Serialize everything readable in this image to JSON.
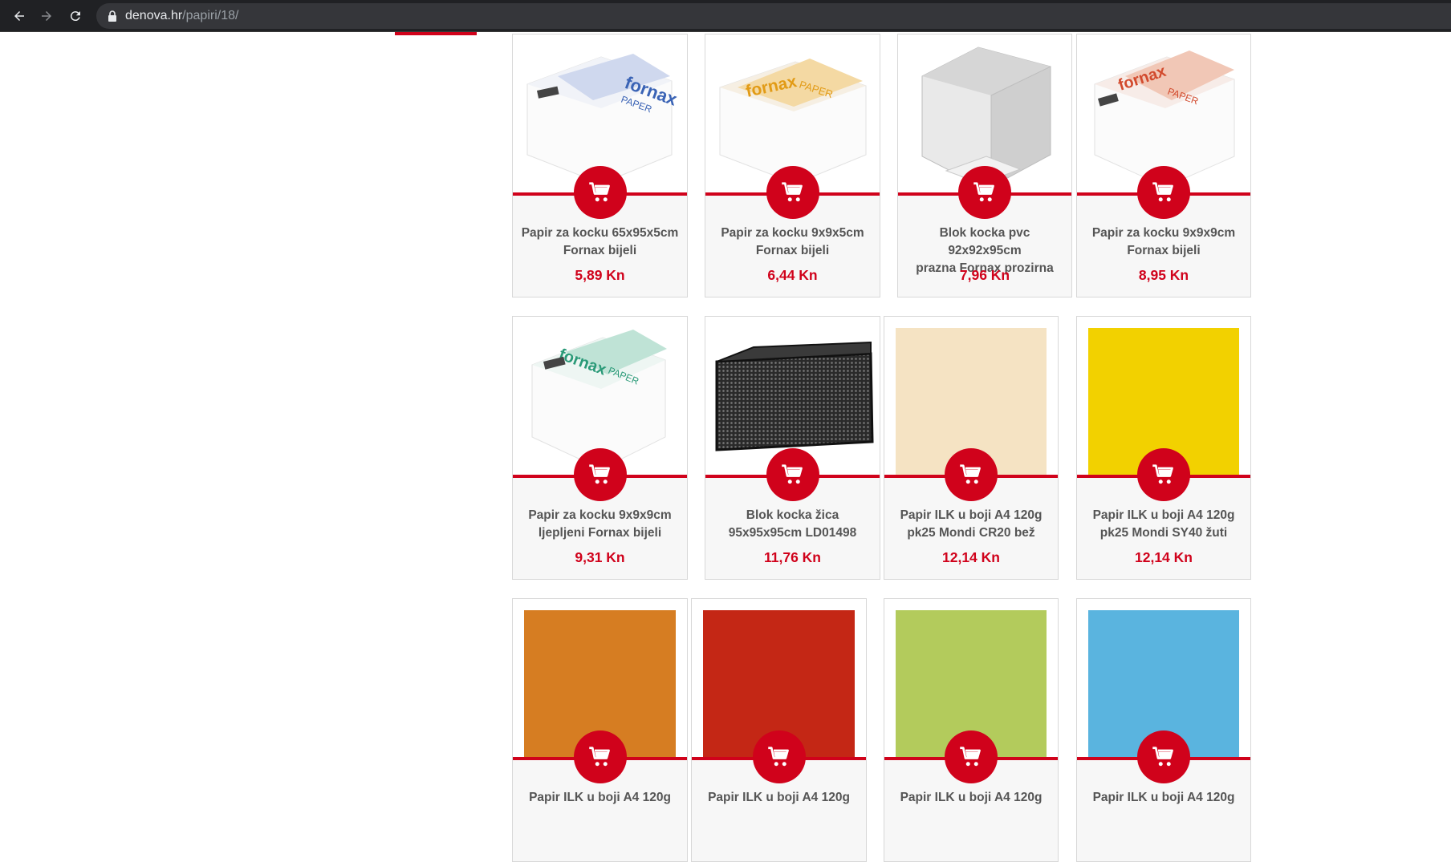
{
  "browser": {
    "url_host": "denova.hr",
    "url_path": "/papiri/18/",
    "back_icon": "back-arrow-icon",
    "forward_icon": "forward-arrow-icon",
    "reload_icon": "reload-icon",
    "lock_icon": "lock-icon"
  },
  "colors": {
    "accent": "#d0021b",
    "price": "#d0021b",
    "title": "#555555"
  },
  "products": [
    {
      "name_line1": "Papir za kocku 65x95x5cm",
      "name_line2": "Fornax bijeli",
      "price": "5,89 Kn",
      "image": "fornax-paper-cube-blue"
    },
    {
      "name_line1": "Papir za kocku 9x9x5cm",
      "name_line2": "Fornax bijeli",
      "price": "6,44 Kn",
      "image": "fornax-paper-cube-yellow"
    },
    {
      "name_line1": "Blok kocka pvc 92x92x95cm",
      "name_line2": "prazna Fornax prozirna",
      "price": "7,96 Kn",
      "image": "transparent-pvc-holder"
    },
    {
      "name_line1": "Papir za kocku 9x9x9cm",
      "name_line2": "Fornax bijeli",
      "price": "8,95 Kn",
      "image": "fornax-paper-cube-red"
    },
    {
      "name_line1": "Papir za kocku 9x9x9cm",
      "name_line2": "ljepljeni Fornax bijeli",
      "price": "9,31 Kn",
      "image": "fornax-paper-cube-green"
    },
    {
      "name_line1": "Blok kocka žica",
      "name_line2": "95x95x95cm LD01498",
      "price": "11,76 Kn",
      "image": "black-mesh-holder"
    },
    {
      "name_line1": "Papir ILK u boji A4 120g",
      "name_line2": "pk25 Mondi CR20 bež",
      "price": "12,14 Kn",
      "image": "swatch",
      "swatch_color": "#f5e3c3"
    },
    {
      "name_line1": "Papir ILK u boji A4 120g",
      "name_line2": "pk25 Mondi SY40 žuti",
      "price": "12,14 Kn",
      "image": "swatch",
      "swatch_color": "#f2d100"
    },
    {
      "name_line1": "Papir ILK u boji A4 120g",
      "name_line2": "",
      "price": "",
      "image": "swatch",
      "swatch_color": "#d67d22"
    },
    {
      "name_line1": "Papir ILK u boji A4 120g",
      "name_line2": "",
      "price": "",
      "image": "swatch",
      "swatch_color": "#c42715"
    },
    {
      "name_line1": "Papir ILK u boji A4 120g",
      "name_line2": "",
      "price": "",
      "image": "swatch",
      "swatch_color": "#b3cb5c"
    },
    {
      "name_line1": "Papir ILK u boji A4 120g",
      "name_line2": "",
      "price": "",
      "image": "swatch",
      "swatch_color": "#5ab4df"
    }
  ]
}
